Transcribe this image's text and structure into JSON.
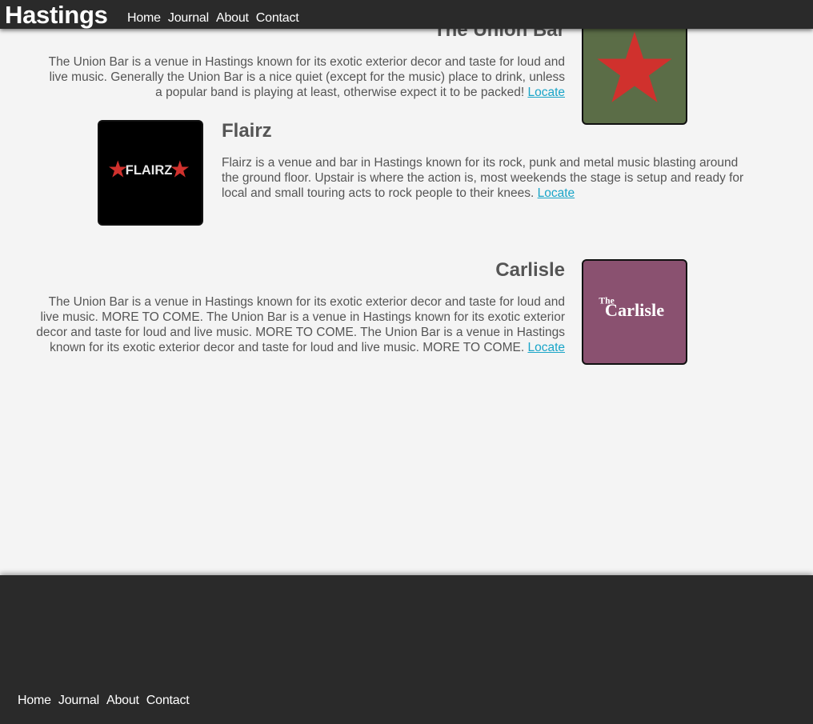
{
  "header": {
    "brand": "Hastings",
    "nav": [
      "Home",
      "Journal",
      "About",
      "Contact"
    ]
  },
  "venues": [
    {
      "title": "The Union Bar",
      "description": "The Union Bar is a venue in Hastings known for its exotic exterior decor and taste for loud and live music. Generally the Union Bar is a nice quiet (except for the music) place to drink, unless a popular band is playing at least, otherwise expect it to be packed!",
      "link": "Locate",
      "image_bg": "#5b6d47",
      "icon": "red-star-icon"
    },
    {
      "title": "Flairz",
      "description": "Flairz is a venue and bar in Hastings known for its rock, punk and metal music blasting around the ground floor. Upstair is where the action is, most weekends the stage is setup and ready for local and small touring acts to rock people to their knees.",
      "link": "Locate",
      "image_bg": "#000000",
      "logo_text": "FLAIRZ"
    },
    {
      "title": "Carlisle",
      "description": "The Union Bar is a venue in Hastings known for its exotic exterior decor and taste for loud and live music. MORE TO COME. The Union Bar is a venue in Hastings known for its exotic exterior decor and taste for loud and live music. MORE TO COME. The Union Bar is a venue in Hastings known for its exotic exterior decor and taste for loud and live music. MORE TO COME.",
      "link": "Locate",
      "image_bg": "#8a5170",
      "logo_small": "The",
      "logo_large": "Carlisle"
    }
  ],
  "footer": {
    "nav": [
      "Home",
      "Journal",
      "About",
      "Contact"
    ]
  },
  "colors": {
    "bar": "#2a2a2a",
    "page": "#f4f4f4",
    "text": "#555555",
    "link": "#1aa5c8",
    "star": "#d0312d"
  }
}
